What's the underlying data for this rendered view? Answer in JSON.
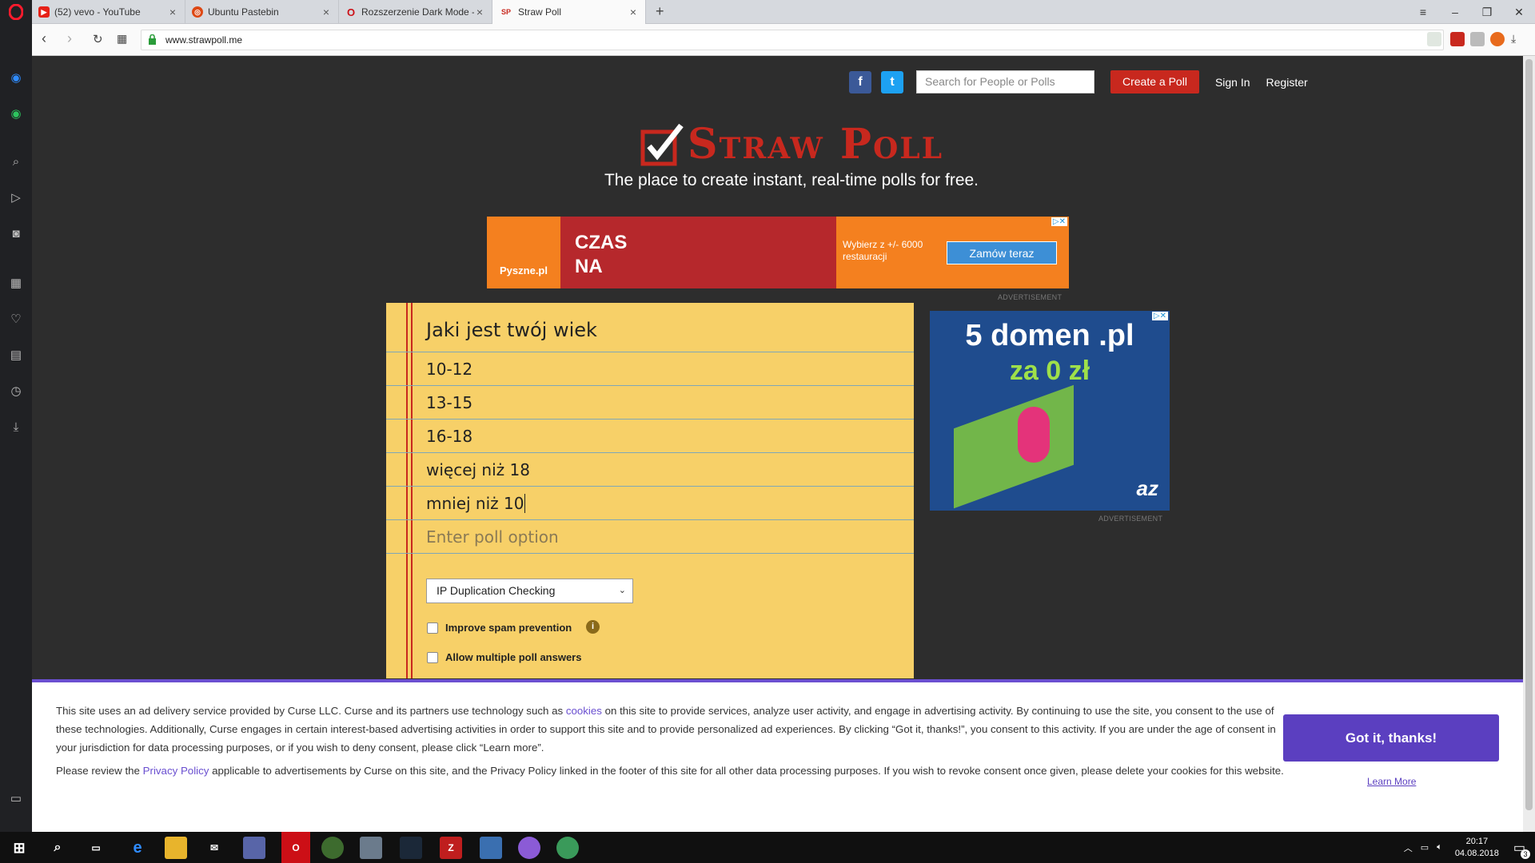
{
  "browser": {
    "tabs": [
      {
        "title": "(52) vevo - YouTube",
        "favicon": "youtube-icon",
        "color": "#e62117"
      },
      {
        "title": "Ubuntu Pastebin",
        "favicon": "ubuntu-icon",
        "color": "#dd4814"
      },
      {
        "title": "Rozszerzenie Dark Mode -",
        "favicon": "opera-icon",
        "color": "#cc0f16"
      },
      {
        "title": "Straw Poll",
        "favicon": "strawpoll-icon",
        "color": "#c8281e",
        "active": true
      }
    ],
    "url": "www.strawpoll.me"
  },
  "header": {
    "search_placeholder": "Search for People or Polls",
    "create_label": "Create a Poll",
    "signin_label": "Sign In",
    "register_label": "Register",
    "facebook": "f",
    "twitter": "t"
  },
  "logo": {
    "text": "Straw Poll",
    "tagline": "The place to create instant, real-time polls for free."
  },
  "ad_top": {
    "brand": "Pyszne.pl",
    "headline": "CZAS NA",
    "text": "Wybierz z +/- 6000 restauracji",
    "cta": "Zamów teraz",
    "label": "ADVERTISEMENT"
  },
  "ad_side": {
    "line1": "5 domen .pl",
    "line2": "za 0 zł",
    "label": "ADVERTISEMENT"
  },
  "poll": {
    "question": "Jaki jest twój wiek",
    "options": [
      "10-12",
      "13-15",
      "16-18",
      "więcej niż 18",
      "mniej niż 10"
    ],
    "option_placeholder": "Enter poll option",
    "duplication_select": "IP Duplication Checking",
    "spam_label": "Improve spam prevention",
    "multiple_label": "Allow multiple poll answers"
  },
  "consent": {
    "p1_a": "This site uses an ad delivery service provided by Curse LLC. Curse and its partners use technology such as ",
    "p1_link": "cookies",
    "p1_b": " on this site to provide services, analyze user activity, and engage in advertising activity. By continuing to use the site, you consent to the use of these technologies. Additionally, Curse engages in certain interest-based advertising activities in order to support this site and to provide personalized ad experiences. By clicking “Got it, thanks!”, you consent to this activity. If you are under the age of consent in your jurisdiction for data processing purposes, or if you wish to deny consent, please click “Learn more”.",
    "p2_a": "Please review the ",
    "p2_link": "Privacy Policy",
    "p2_b": " applicable to advertisements by Curse on this site, and the Privacy Policy linked in the footer of this site for all other data processing purposes. If you wish to revoke consent once given, please delete your cookies for this website.",
    "gotit_label": "Got it, thanks!",
    "learn_label": "Learn More"
  },
  "taskbar": {
    "time": "20:17",
    "date": "04.08.2018",
    "notifications": "3"
  }
}
